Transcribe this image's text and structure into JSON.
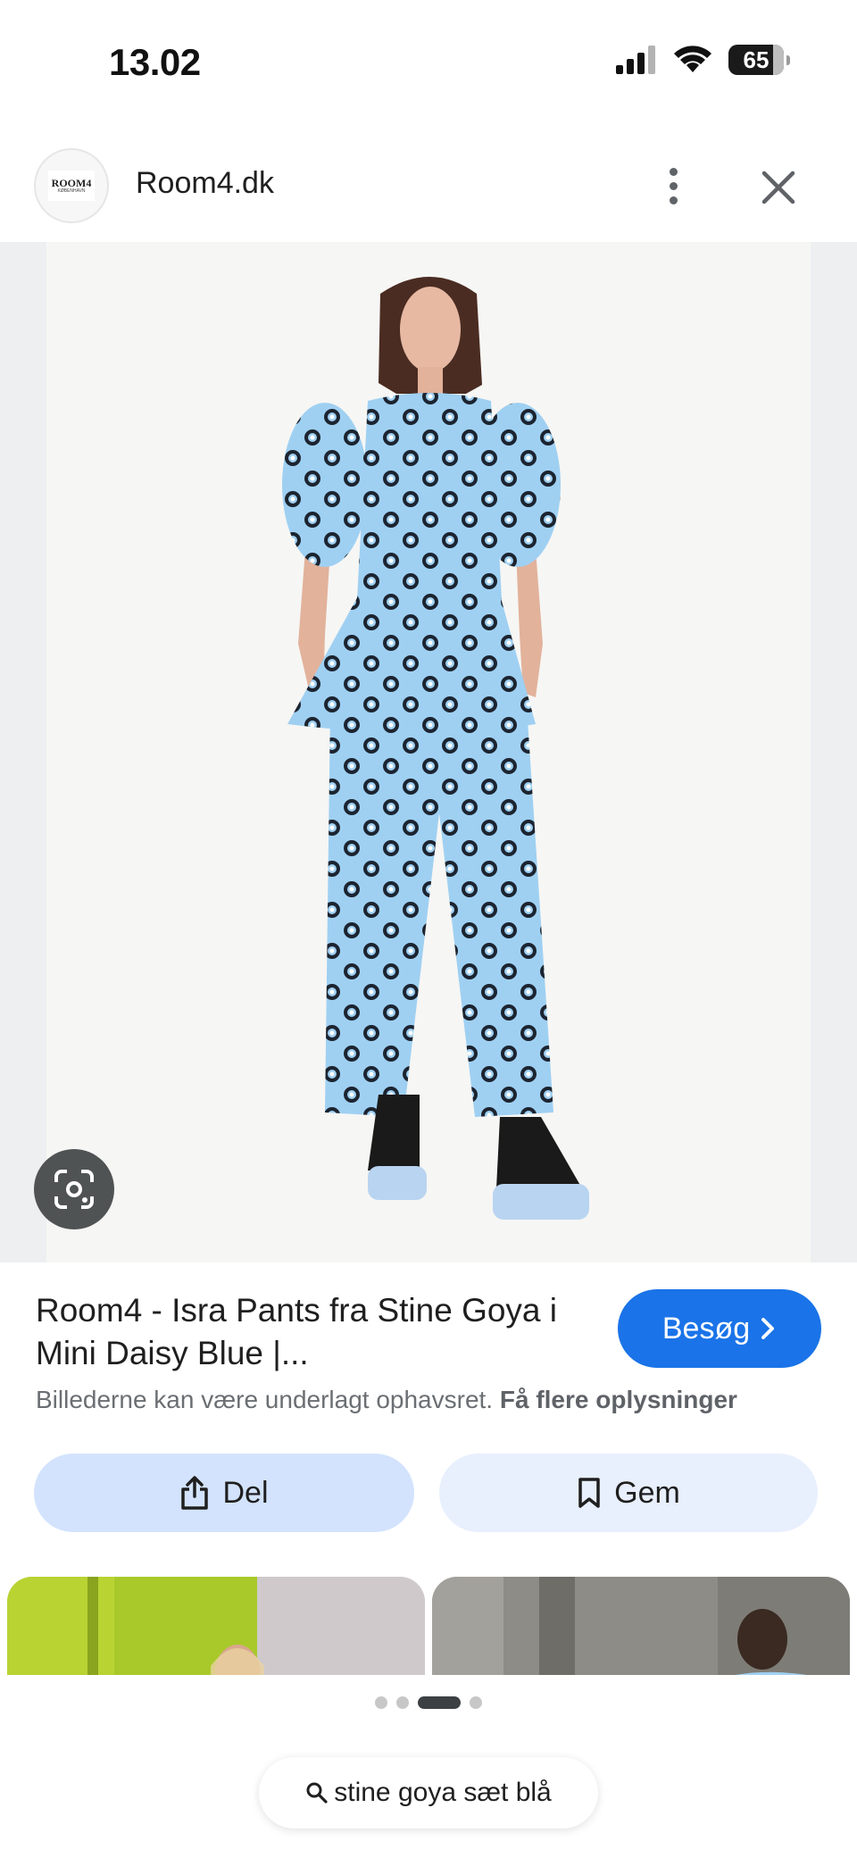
{
  "status_bar": {
    "time": "13.02",
    "battery": "65"
  },
  "source": {
    "logo_text": "ROOM4",
    "logo_subtext": "KØBENHAVN",
    "name": "Room4.dk"
  },
  "result": {
    "title": "Room4 - Isra Pants fra Stine Goya i Mini Daisy Blue |...",
    "visit_label": "Besøg",
    "copyright_text": "Billederne kan være underlagt ophavsret.",
    "more_info_label": "Få flere oplysninger"
  },
  "actions": {
    "share_label": "Del",
    "save_label": "Gem"
  },
  "pager": {
    "count": 4,
    "active_index": 2
  },
  "search": {
    "query": "stine goya sæt blå"
  },
  "colors": {
    "accent": "#1a73e8",
    "share_button_bg": "#d3e3fd",
    "save_button_bg": "#e8effd",
    "garment": "#9fd0f2"
  },
  "icons": {
    "signal": "cellular-signal-icon",
    "wifi": "wifi-icon",
    "battery": "battery-icon",
    "more": "more-vert-icon",
    "close": "close-icon",
    "lens": "google-lens-icon",
    "share": "share-icon",
    "save": "bookmark-icon",
    "search": "search-icon"
  }
}
